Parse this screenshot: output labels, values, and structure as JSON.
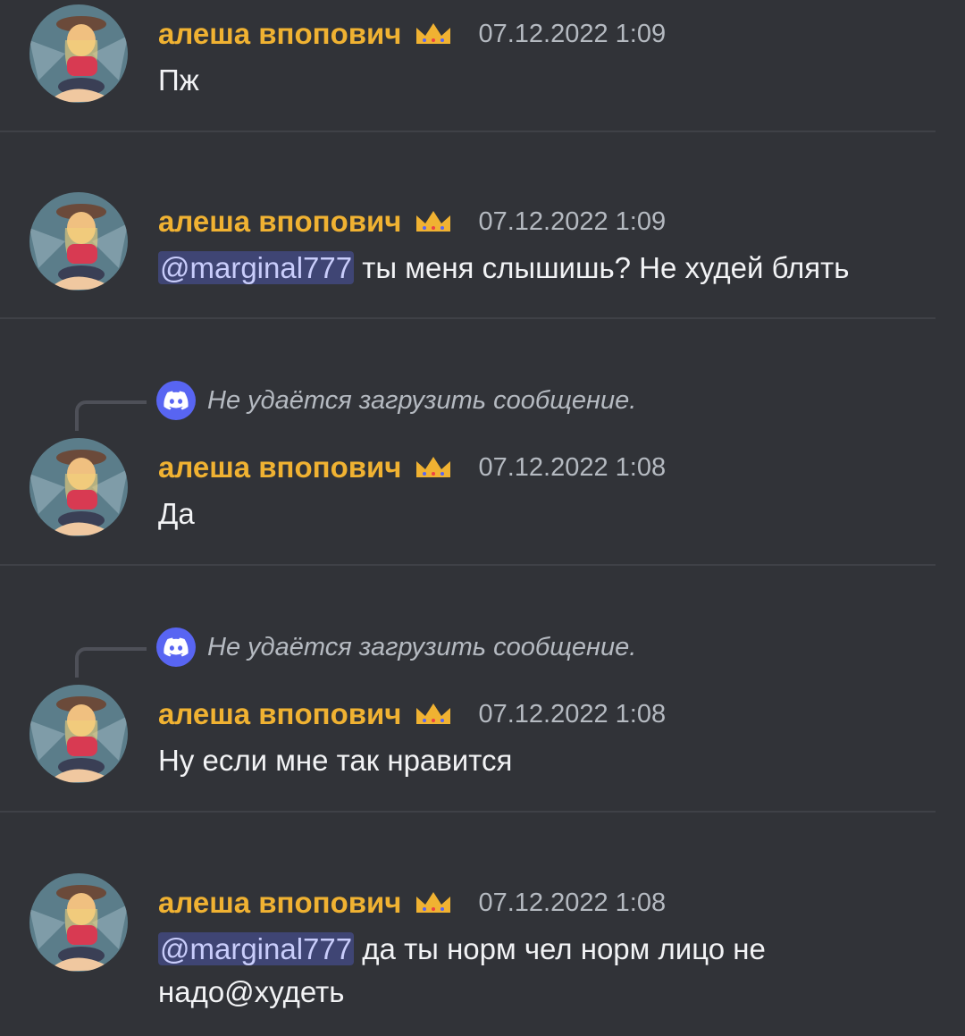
{
  "messages": [
    {
      "username": "алеша впопович",
      "badge_icon": "crown-icon",
      "timestamp": "07.12.2022 1:09",
      "text": "Пж"
    },
    {
      "username": "алеша впопович",
      "badge_icon": "crown-icon",
      "timestamp": "07.12.2022 1:09",
      "mention": "@marginal777",
      "text": " ты меня слышишь? Не худей блять"
    },
    {
      "reply_text": "Не удаётся загрузить сообщение.",
      "username": "алеша впопович",
      "badge_icon": "crown-icon",
      "timestamp": "07.12.2022 1:08",
      "text": "Да"
    },
    {
      "reply_text": "Не удаётся загрузить сообщение.",
      "username": "алеша впопович",
      "badge_icon": "crown-icon",
      "timestamp": "07.12.2022 1:08",
      "text": "Ну если мне так нравится"
    },
    {
      "username": "алеша впопович",
      "badge_icon": "crown-icon",
      "timestamp": "07.12.2022 1:08",
      "mention": "@marginal777",
      "text": " да ты норм чел норм лицо не надо@худеть"
    }
  ],
  "colors": {
    "background": "#313338",
    "username": "#f0b232",
    "timestamp": "#b5bac1",
    "mention_bg": "#3f4574",
    "mention_text": "#c9cdfb",
    "reply_icon_bg": "#5865f2"
  }
}
